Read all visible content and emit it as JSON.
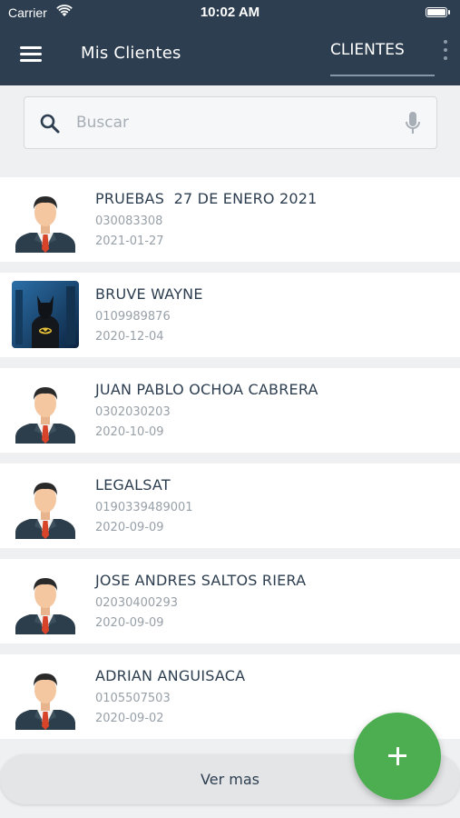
{
  "status_bar": {
    "carrier": "Carrier",
    "time": "10:02 AM"
  },
  "app_bar": {
    "title": "Mis Clientes",
    "tab_label": "CLIENTES"
  },
  "search": {
    "placeholder": "Buscar",
    "value": ""
  },
  "clients": [
    {
      "name": "PRUEBAS  27 DE ENERO 2021",
      "id": "030083308",
      "date": "2021-01-27",
      "avatar": "businessman-avatar"
    },
    {
      "name": "BRUVE WAYNE",
      "id": "0109989876",
      "date": "2020-12-04",
      "avatar": "batman-photo"
    },
    {
      "name": "JUAN PABLO OCHOA CABRERA",
      "id": "0302030203",
      "date": "2020-10-09",
      "avatar": "businessman-avatar"
    },
    {
      "name": "LEGALSAT",
      "id": "0190339489001",
      "date": "2020-09-09",
      "avatar": "businessman-avatar"
    },
    {
      "name": "JOSE ANDRES SALTOS RIERA",
      "id": "02030400293",
      "date": "2020-09-09",
      "avatar": "businessman-avatar"
    },
    {
      "name": "ADRIAN ANGUISACA",
      "id": "0105507503",
      "date": "2020-09-02",
      "avatar": "businessman-avatar"
    }
  ],
  "footer": {
    "ver_mas_label": "Ver mas"
  },
  "colors": {
    "header": "#2d3e50",
    "fab": "#4cae50",
    "text_primary": "#2d3e50",
    "text_secondary": "#98a0a8"
  }
}
